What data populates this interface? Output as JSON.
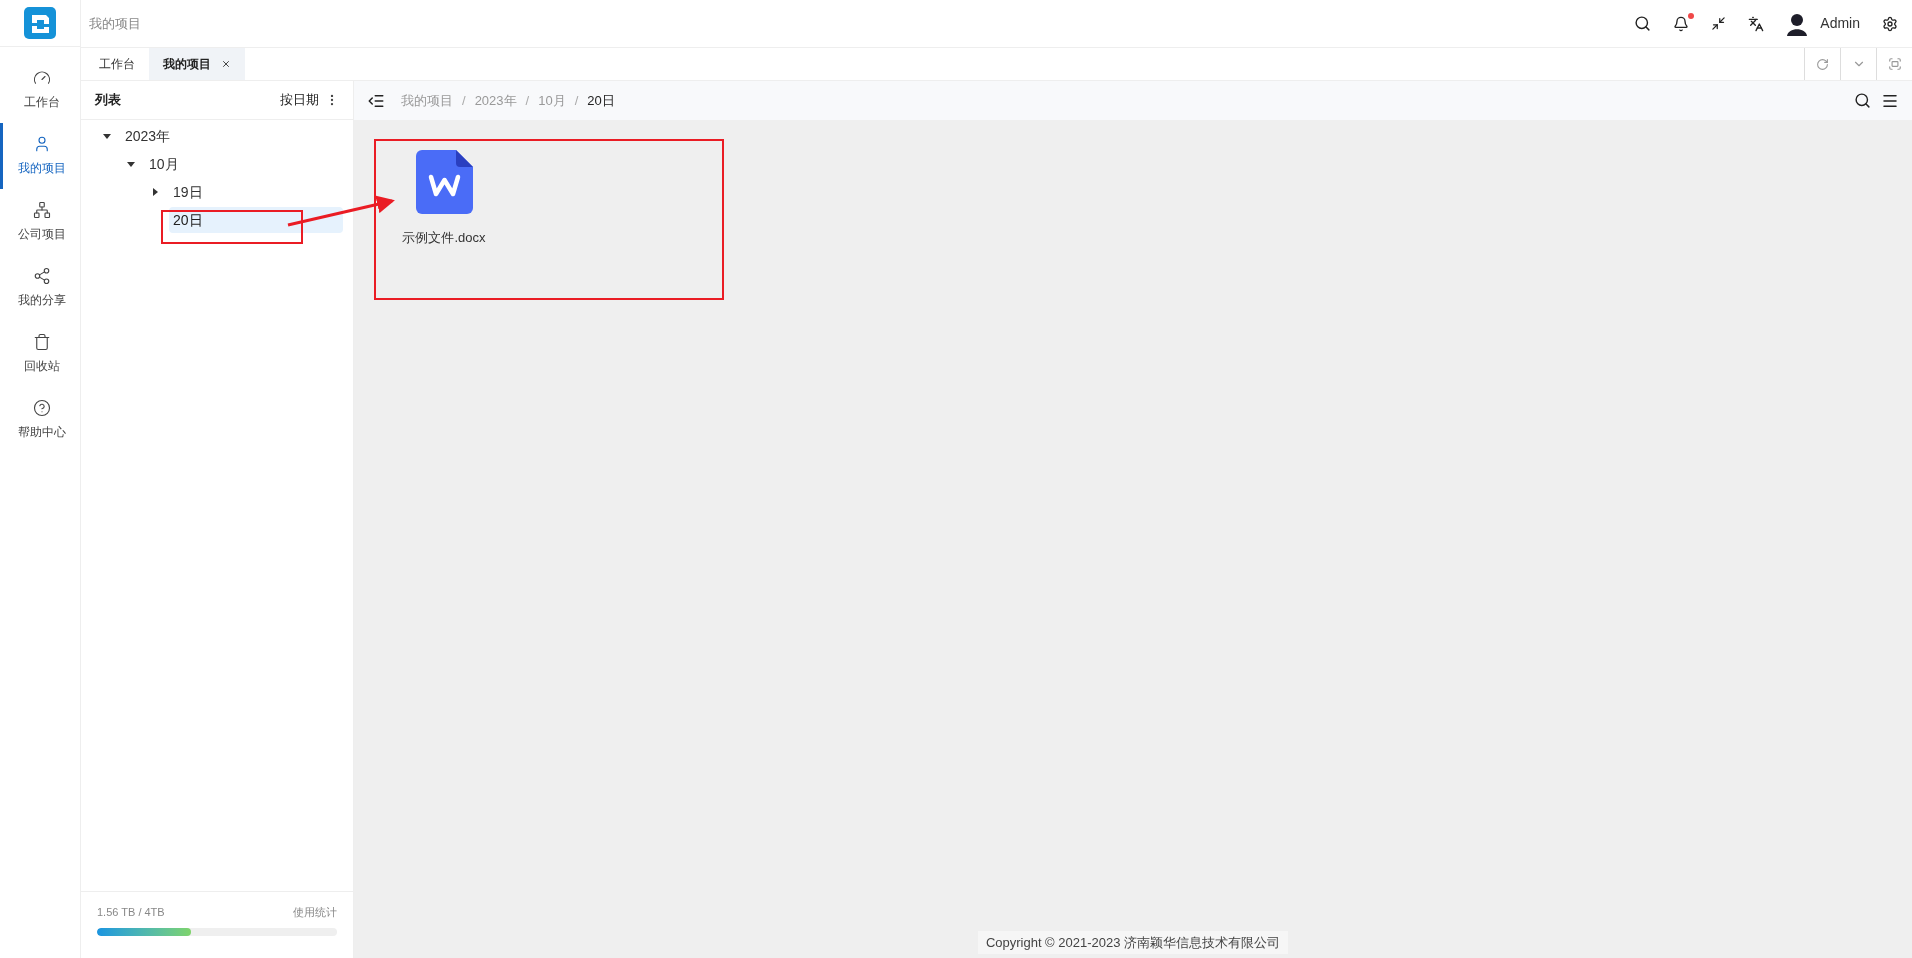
{
  "header": {
    "title": "我的项目",
    "user": "Admin",
    "notification_dot": true
  },
  "nav": [
    {
      "label": "工作台",
      "selected": false
    },
    {
      "label": "我的项目",
      "selected": true
    },
    {
      "label": "公司项目",
      "selected": false
    },
    {
      "label": "我的分享",
      "selected": false
    },
    {
      "label": "回收站",
      "selected": false
    },
    {
      "label": "帮助中心",
      "selected": false
    }
  ],
  "tabs": [
    {
      "label": "工作台",
      "selected": false,
      "closable": false
    },
    {
      "label": "我的项目",
      "selected": true,
      "closable": true
    }
  ],
  "tree_panel": {
    "title": "列表",
    "sort": "按日期",
    "tree": [
      {
        "label": "2023年",
        "kind": "branch",
        "expanded": true,
        "selected": false,
        "children": [
          {
            "label": "10月",
            "kind": "branch",
            "expanded": true,
            "selected": false,
            "children": [
              {
                "label": "19日",
                "kind": "branch",
                "expanded": false,
                "selected": false
              },
              {
                "label": "20日",
                "kind": "leaf",
                "selected": true
              }
            ]
          }
        ]
      }
    ],
    "storage": {
      "usage": "1.56 TB / 4TB",
      "link": "使用统计",
      "level": 0.39
    }
  },
  "breadcrumb": {
    "separator": "/",
    "items": [
      "我的项目",
      "2023年",
      "10月",
      "20日"
    ]
  },
  "files": [
    {
      "name": "示例文件.docx",
      "kind": "word"
    }
  ],
  "footer": "Copyright © 2021-2023 济南颖华信息技术有限公司"
}
